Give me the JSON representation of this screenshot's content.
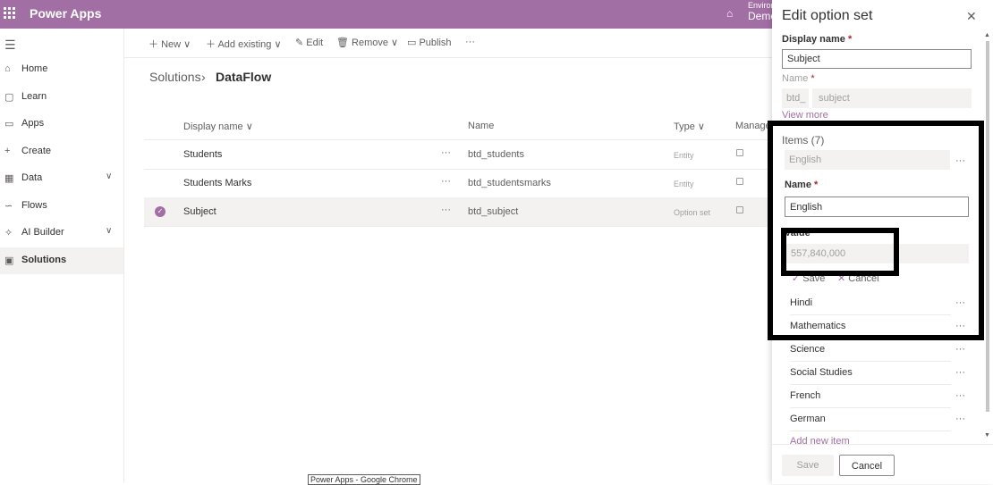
{
  "app": {
    "name": "Power Apps",
    "env_label": "Environ",
    "env_value": "Demo"
  },
  "nav": [
    {
      "label": "Home",
      "icon": "home-icon",
      "glyph": "⌂"
    },
    {
      "label": "Learn",
      "icon": "book-icon",
      "glyph": "▢"
    },
    {
      "label": "Apps",
      "icon": "apps-icon",
      "glyph": "▭"
    },
    {
      "label": "Create",
      "icon": "plus-icon",
      "glyph": "+"
    },
    {
      "label": "Data",
      "icon": "table-icon",
      "glyph": "▦"
    },
    {
      "label": "Flows",
      "icon": "flow-icon",
      "glyph": "∽"
    },
    {
      "label": "AI Builder",
      "icon": "ai-icon",
      "glyph": "✧"
    },
    {
      "label": "Solutions",
      "icon": "solutions-icon",
      "glyph": "▣"
    }
  ],
  "commands": {
    "new": "New",
    "add_existing": "Add existing",
    "edit": "Edit",
    "remove": "Remove",
    "publish": "Publish",
    "more": "···"
  },
  "breadcrumb": {
    "parent": "Solutions",
    "current": "DataFlow"
  },
  "table": {
    "columns": [
      "Display name",
      "Name",
      "Type",
      "Manage"
    ],
    "rows": [
      {
        "display": "Students",
        "name": "btd_students",
        "type": "Entity"
      },
      {
        "display": "Students Marks",
        "name": "btd_studentsmarks",
        "type": "Entity"
      },
      {
        "display": "Subject",
        "name": "btd_subject",
        "type": "Option set"
      }
    ]
  },
  "panel": {
    "title": "Edit option set",
    "display_name_label": "Display name",
    "display_name_value": "Subject",
    "name_label": "Name",
    "name_prefix": "btd_",
    "name_value": "subject",
    "view_more": "View more",
    "items_label": "Items (7)",
    "selected_item": "English",
    "item_name_label": "Name",
    "item_name_value": "English",
    "value_label": "Value",
    "value_value": "557,840,000",
    "save_label": "Save",
    "cancel_label": "Cancel",
    "items": [
      "Hindi",
      "Mathematics",
      "Science",
      "Social Studies",
      "French",
      "German"
    ],
    "add_new_item": "Add new item",
    "footer_save": "Save",
    "footer_cancel": "Cancel"
  },
  "taskbar": "Power Apps - Google Chrome",
  "colors": {
    "accent": "#a26fa4",
    "topbar": "#a26fa4"
  }
}
